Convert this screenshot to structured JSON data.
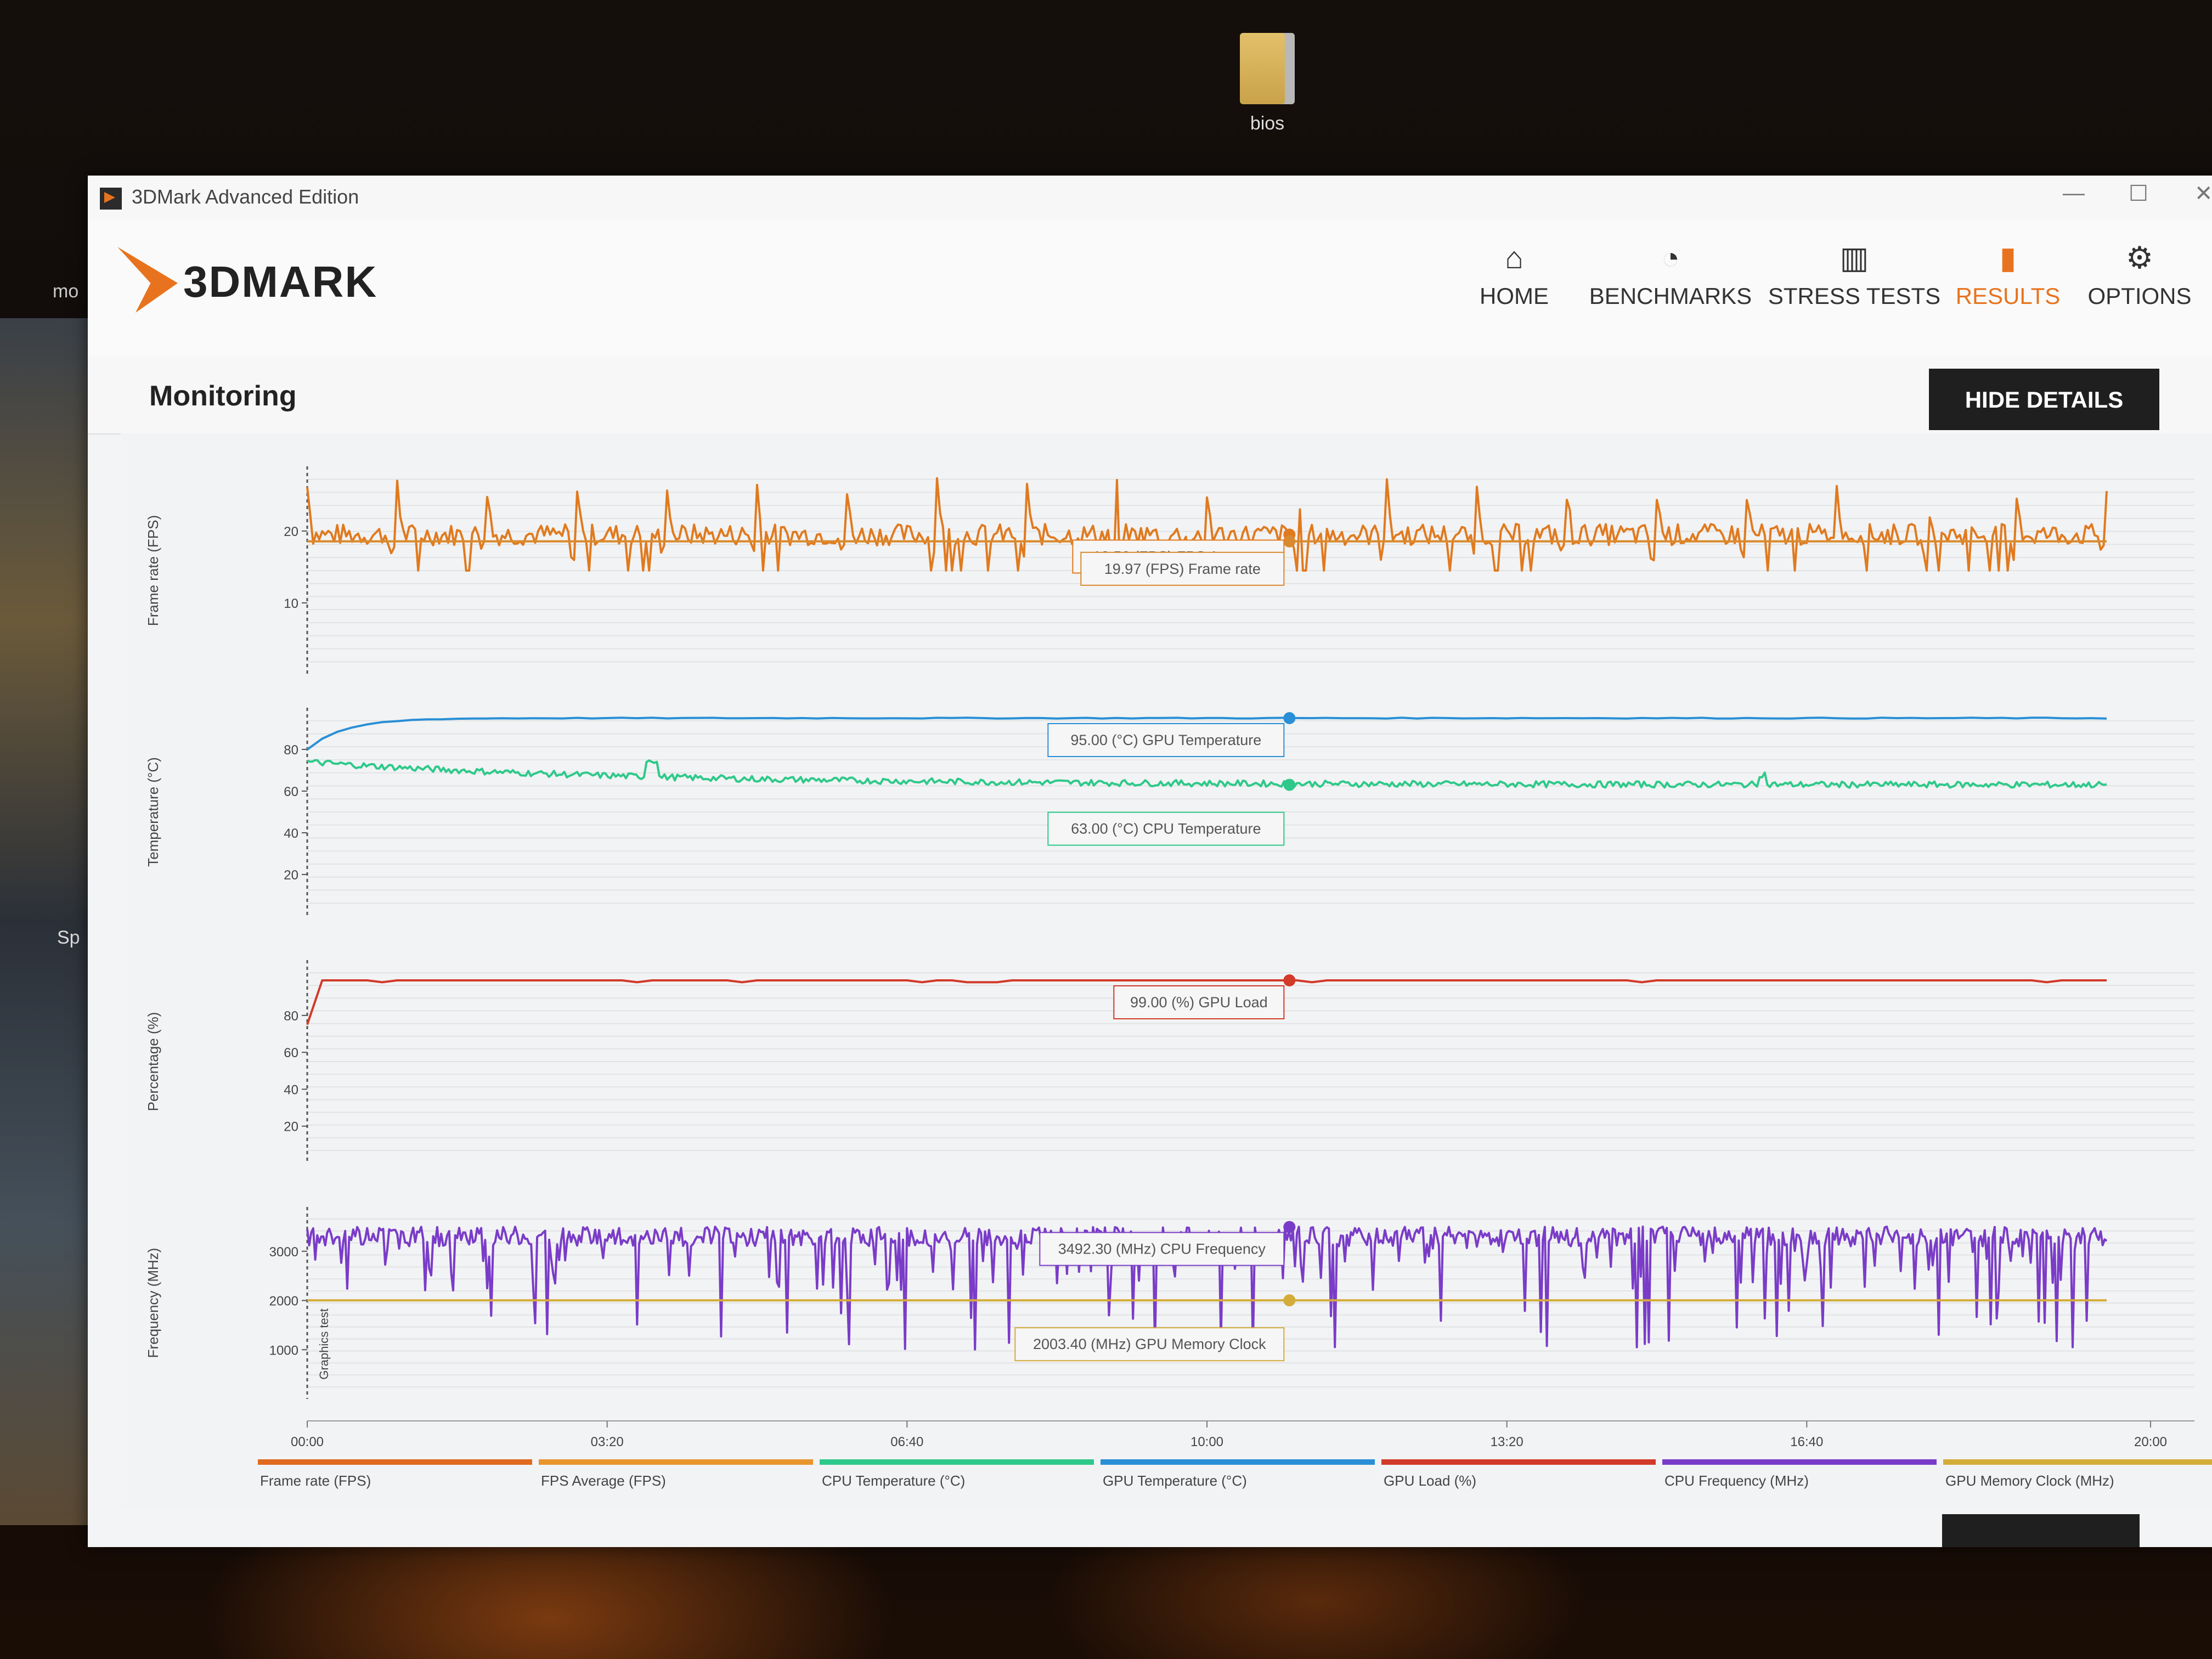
{
  "desktop": {
    "folder_label": "bios",
    "left_label_1": "mo",
    "left_label_2": "Sp"
  },
  "window": {
    "title": "3DMark Advanced Edition",
    "controls": {
      "minimize": "—",
      "maximize": "☐",
      "close": "✕"
    }
  },
  "header": {
    "logo_text": "3DMARK",
    "nav": [
      {
        "label": "HOME",
        "icon": "home-icon",
        "glyph": "⌂",
        "active": false
      },
      {
        "label": "BENCHMARKS",
        "icon": "gauge-icon",
        "glyph": "◔",
        "active": false
      },
      {
        "label": "STRESS TESTS",
        "icon": "bar-chart-icon",
        "glyph": "▥",
        "active": false
      },
      {
        "label": "RESULTS",
        "icon": "results-icon",
        "glyph": "▮",
        "active": true
      },
      {
        "label": "OPTIONS",
        "icon": "gear-icon",
        "glyph": "⚙",
        "active": false
      }
    ],
    "accent_color": "#e8731e"
  },
  "page": {
    "title": "Monitoring",
    "hide_details_label": "HIDE DETAILS"
  },
  "chart_data": {
    "type": "line",
    "x_ticks": [
      "00:00",
      "03:20",
      "06:40",
      "10:00",
      "13:20",
      "16:40",
      "20:00"
    ],
    "x_range": [
      0,
      1200
    ],
    "marker_x": 655,
    "side_label": "Graphics test",
    "panels": [
      {
        "ylabel": "Frame rate (FPS)",
        "ylim": [
          0,
          29
        ],
        "yticks": [
          10,
          20
        ],
        "series": [
          {
            "name": "Frame rate (FPS)",
            "color": "#e07a1f",
            "pattern": "spiky",
            "base": 19.5,
            "amp": 8
          },
          {
            "name": "FPS Average (FPS)",
            "color": "#d98a2e",
            "pattern": "flat",
            "base": 18.56
          }
        ],
        "tooltips": [
          "18.56 (FPS) FPS Average",
          "19.97 (FPS) Frame rate"
        ]
      },
      {
        "ylabel": "Temperature (°C)",
        "ylim": [
          0,
          100
        ],
        "yticks": [
          20,
          40,
          60,
          80
        ],
        "series": [
          {
            "name": "GPU Temperature (°C)",
            "color": "#2a8fd6",
            "pattern": "rise",
            "start": 80,
            "base": 95
          },
          {
            "name": "CPU Temperature (°C)",
            "color": "#2ec98a",
            "pattern": "noisy-decay",
            "start": 74,
            "base": 63
          }
        ],
        "tooltips": [
          "95.00 (°C) GPU Temperature",
          "63.00 (°C) CPU Temperature"
        ]
      },
      {
        "ylabel": "Percentage (%)",
        "ylim": [
          0,
          110
        ],
        "yticks": [
          20,
          40,
          60,
          80
        ],
        "series": [
          {
            "name": "GPU Load (%)",
            "color": "#d23a2a",
            "pattern": "step",
            "start": 75,
            "base": 99
          }
        ],
        "tooltips": [
          "99.00 (%) GPU Load"
        ]
      },
      {
        "ylabel": "Frequency (MHz)",
        "ylim": [
          0,
          3900
        ],
        "yticks": [
          1000,
          2000,
          3000
        ],
        "series": [
          {
            "name": "CPU Frequency (MHz)",
            "color": "#7a3cc8",
            "pattern": "dips",
            "base": 3500,
            "low": 1000
          },
          {
            "name": "GPU Memory Clock (MHz)",
            "color": "#d4ac3a",
            "pattern": "flat",
            "base": 2003.4
          }
        ],
        "tooltips": [
          "3492.30 (MHz) CPU Frequency",
          "2003.40 (MHz) GPU Memory Clock"
        ]
      }
    ],
    "legend": [
      {
        "name": "Frame rate (FPS)",
        "color": "#e06a1f"
      },
      {
        "name": "FPS Average (FPS)",
        "color": "#e8952e"
      },
      {
        "name": "CPU Temperature (°C)",
        "color": "#2ec98a"
      },
      {
        "name": "GPU Temperature (°C)",
        "color": "#2a8fd6"
      },
      {
        "name": "GPU Load (%)",
        "color": "#d23a2a"
      },
      {
        "name": "CPU Frequency (MHz)",
        "color": "#7a3cc8"
      },
      {
        "name": "GPU Memory Clock (MHz)",
        "color": "#d4ac3a"
      }
    ],
    "grid": true,
    "legend_position": "bottom"
  }
}
